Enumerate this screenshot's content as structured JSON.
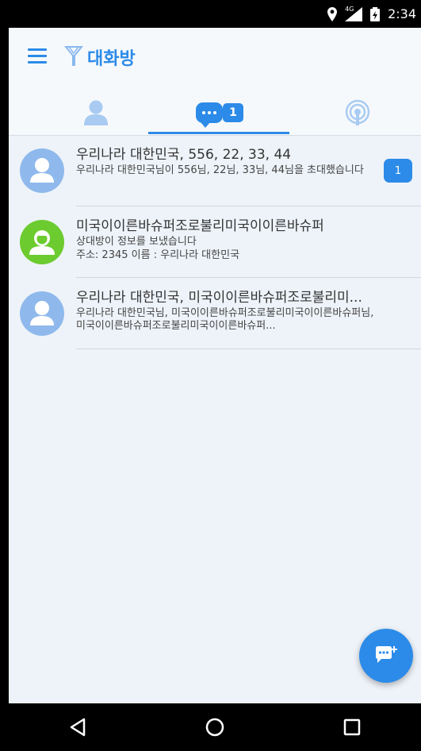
{
  "status_bar": {
    "time": "2:34",
    "network": "4G"
  },
  "app_bar": {
    "title": "대화방",
    "chat_tab_badge": "1"
  },
  "chat_list": [
    {
      "title": "우리나라 대한민국, 556, 22, 33, 44",
      "subtitle": "우리나라 대한민국님이 556님, 22님, 33님, 44님을 초대했습니다",
      "unread": "1",
      "avatar": "person-silhouette-icon"
    },
    {
      "title": "미국이이른바슈퍼조로불리미국이이른바슈퍼",
      "subtitle": "상대방이 정보를 보냈습니다",
      "subtitle2": "주소: 2345 이름 : 우리나라 대한민국",
      "avatar": "green-user-icon"
    },
    {
      "title": "우리나라 대한민국, 미국이이른바슈퍼조로불리미...",
      "subtitle": "우리나라 대한민국님, 미국이이른바슈퍼조로불리미국이이른바슈퍼님, 미국이이른바슈퍼조로불리미국이이른바슈퍼...",
      "avatar": "person-silhouette-icon"
    }
  ],
  "colors": {
    "accent": "#2c8be8",
    "background": "#eef3f9",
    "avatar_blue": "#8fb9ec",
    "avatar_green": "#6ccb2f"
  }
}
